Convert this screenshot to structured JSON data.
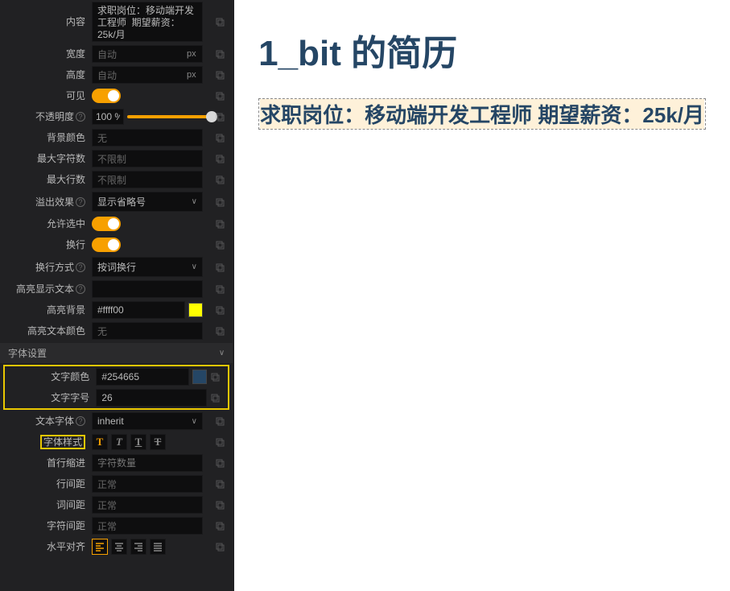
{
  "props": {
    "content": {
      "label": "内容",
      "value": "求职岗位：移动端开发工程师  期望薪资：25k/月"
    },
    "width": {
      "label": "宽度",
      "value": "自动",
      "unit": "px"
    },
    "height": {
      "label": "高度",
      "value": "自动",
      "unit": "px"
    },
    "visible": {
      "label": "可见"
    },
    "opacity": {
      "label": "不透明度",
      "value": "100 %"
    },
    "bgcolor": {
      "label": "背景颜色",
      "value": "无"
    },
    "maxchars": {
      "label": "最大字符数",
      "value": "不限制"
    },
    "maxlines": {
      "label": "最大行数",
      "value": "不限制"
    },
    "overflow": {
      "label": "溢出效果",
      "value": "显示省略号"
    },
    "allow_select": {
      "label": "允许选中"
    },
    "wrap": {
      "label": "换行"
    },
    "wrap_mode": {
      "label": "换行方式",
      "value": "按词换行"
    },
    "highlight_text": {
      "label": "高亮显示文本",
      "value": ""
    },
    "highlight_bg": {
      "label": "高亮背景",
      "value": "#ffff00"
    },
    "highlight_color": {
      "label": "高亮文本颜色",
      "value": "无"
    }
  },
  "font_section": {
    "title": "字体设置"
  },
  "font": {
    "color": {
      "label": "文字颜色",
      "value": "#254665"
    },
    "size": {
      "label": "文字字号",
      "value": "26"
    },
    "family": {
      "label": "文本字体",
      "value": "inherit"
    },
    "style": {
      "label": "字体样式"
    },
    "indent": {
      "label": "首行缩进",
      "placeholder": "字符数量"
    },
    "line_height": {
      "label": "行间距",
      "value": "正常"
    },
    "word_spacing": {
      "label": "词间距",
      "value": "正常"
    },
    "letter_spacing": {
      "label": "字符间距",
      "value": "正常"
    },
    "align": {
      "label": "水平对齐"
    }
  },
  "canvas": {
    "title": "1_bit 的简历",
    "subtitle": "求职岗位：移动端开发工程师  期望薪资：25k/月"
  }
}
